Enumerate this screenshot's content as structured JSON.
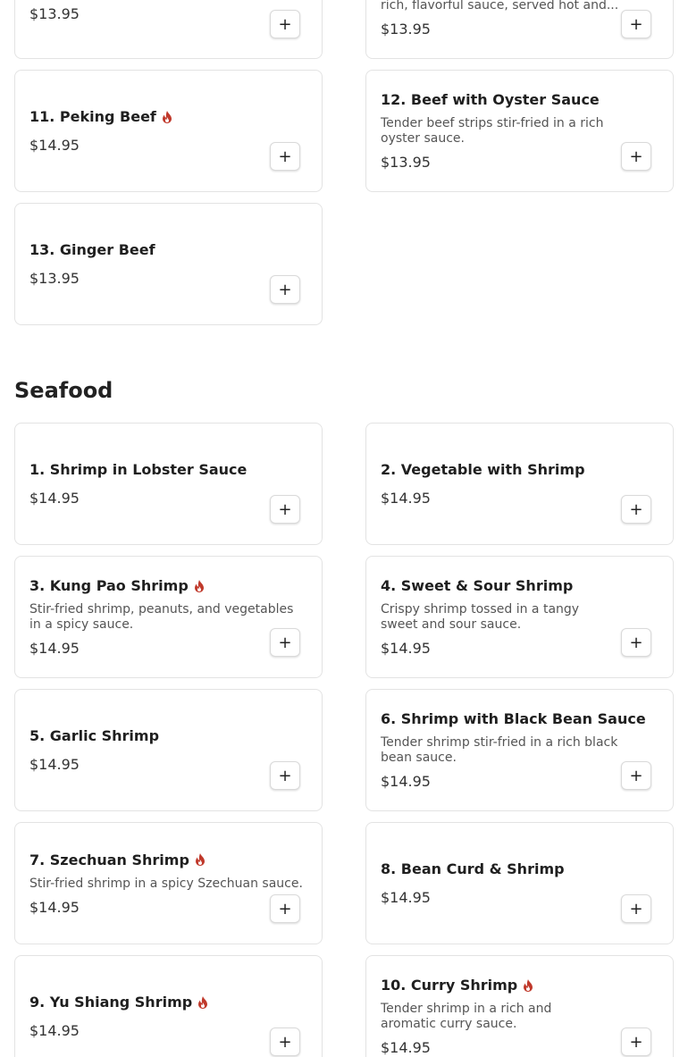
{
  "beef": {
    "items": [
      {
        "price": "$13.95"
      },
      {
        "desc": "rich, flavorful sauce, served hot and...",
        "price": "$13.95"
      },
      {
        "name": "11. Peking Beef",
        "price": "$14.95",
        "spicy": true
      },
      {
        "name": "12. Beef with Oyster Sauce",
        "desc": "Tender beef strips stir-fried in a rich oyster sauce.",
        "price": "$13.95"
      },
      {
        "name": "13. Ginger Beef",
        "price": "$13.95"
      }
    ]
  },
  "seafood": {
    "title": "Seafood",
    "items": [
      {
        "name": "1. Shrimp in Lobster Sauce",
        "price": "$14.95"
      },
      {
        "name": "2. Vegetable with Shrimp",
        "price": "$14.95"
      },
      {
        "name": "3. Kung Pao Shrimp",
        "desc": "Stir-fried shrimp, peanuts, and vegetables in a spicy sauce.",
        "price": "$14.95",
        "spicy": true
      },
      {
        "name": "4. Sweet & Sour Shrimp",
        "desc": "Crispy shrimp tossed in a tangy sweet and sour sauce.",
        "price": "$14.95"
      },
      {
        "name": "5. Garlic Shrimp",
        "price": "$14.95"
      },
      {
        "name": "6. Shrimp with Black Bean Sauce",
        "desc": "Tender shrimp stir-fried in a rich black bean sauce.",
        "price": "$14.95"
      },
      {
        "name": "7. Szechuan Shrimp",
        "desc": "Stir-fried shrimp in a spicy Szechuan sauce.",
        "price": "$14.95",
        "spicy": true
      },
      {
        "name": "8. Bean Curd & Shrimp",
        "price": "$14.95"
      },
      {
        "name": "9. Yu Shiang Shrimp",
        "price": "$14.95",
        "spicy": true
      },
      {
        "name": "10. Curry Shrimp",
        "desc": "Tender shrimp in a rich and aromatic curry sauce.",
        "price": "$14.95",
        "spicy": true
      }
    ]
  },
  "add_button_label": "+",
  "colors": {
    "spicy_icon": "#c0392b",
    "border": "#e3e3e3"
  },
  "icons": {
    "spicy": "flame-icon",
    "add": "plus-icon"
  }
}
